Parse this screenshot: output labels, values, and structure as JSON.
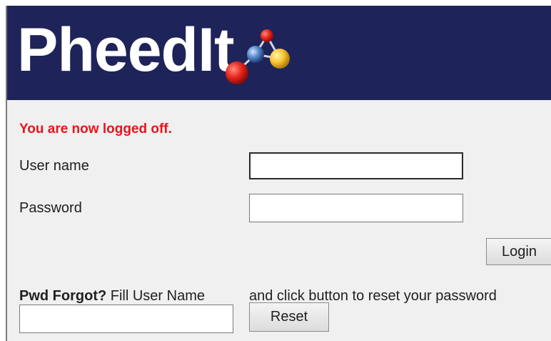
{
  "header": {
    "logo_text": "PheedIt"
  },
  "status": {
    "message": "You are now logged off."
  },
  "login": {
    "username_label": "User name",
    "username_value": "",
    "password_label": "Password",
    "password_value": "",
    "login_button": "Login"
  },
  "forgot": {
    "bold_label": "Pwd Forgot?",
    "label_rest": " Fill User Name",
    "instruction": "and click button to reset your password",
    "username_value": "",
    "reset_button": "Reset"
  },
  "colors": {
    "banner": "#1e2459",
    "status_message": "#e8141c",
    "background": "#f0f0f0"
  }
}
